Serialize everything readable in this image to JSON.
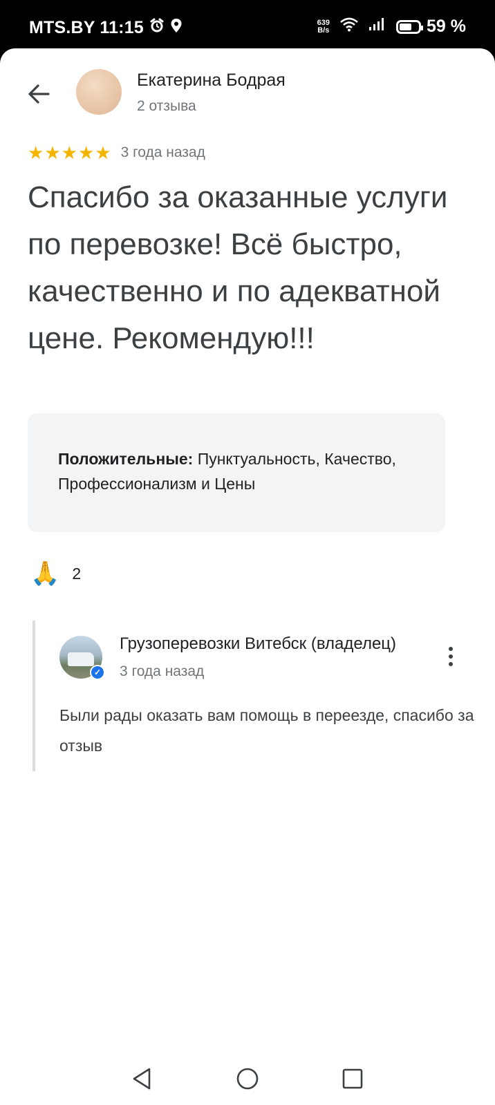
{
  "status_bar": {
    "carrier_time": "MTS.BY 11:15",
    "net_speed_value": "639",
    "net_speed_unit": "B/s",
    "battery": "59 %"
  },
  "review": {
    "author_name": "Екатерина Бодрая",
    "author_meta": "2 отзыва",
    "rating": 5,
    "date": "3 года назад",
    "text": "Спасибо за оказанные услуги по перевозке! Всё быстро, качественно и по адекватной цене. Рекомендую!!!",
    "attributes_label": "Положительные:",
    "attributes_value": " Пунктуальность, Качество, Профессионализм и Цены",
    "reaction_emoji": "🙏",
    "reaction_count": "2"
  },
  "owner_reply": {
    "name": "Грузоперевозки Витебск (владелец)",
    "date": "3 года назад",
    "text": "Были рады оказать вам помощь в переезде, спасибо за отзыв"
  },
  "colors": {
    "star": "#f4b400",
    "verified": "#1a73e8",
    "attr_bg": "#f3f4f6"
  },
  "icons": [
    "alarm-icon",
    "location-icon",
    "wifi-icon",
    "signal-icon",
    "battery-icon",
    "back-arrow-icon",
    "star-icon",
    "pray-emoji-icon",
    "verified-icon",
    "more-vert-icon",
    "nav-back-icon",
    "nav-home-icon",
    "nav-recents-icon"
  ]
}
